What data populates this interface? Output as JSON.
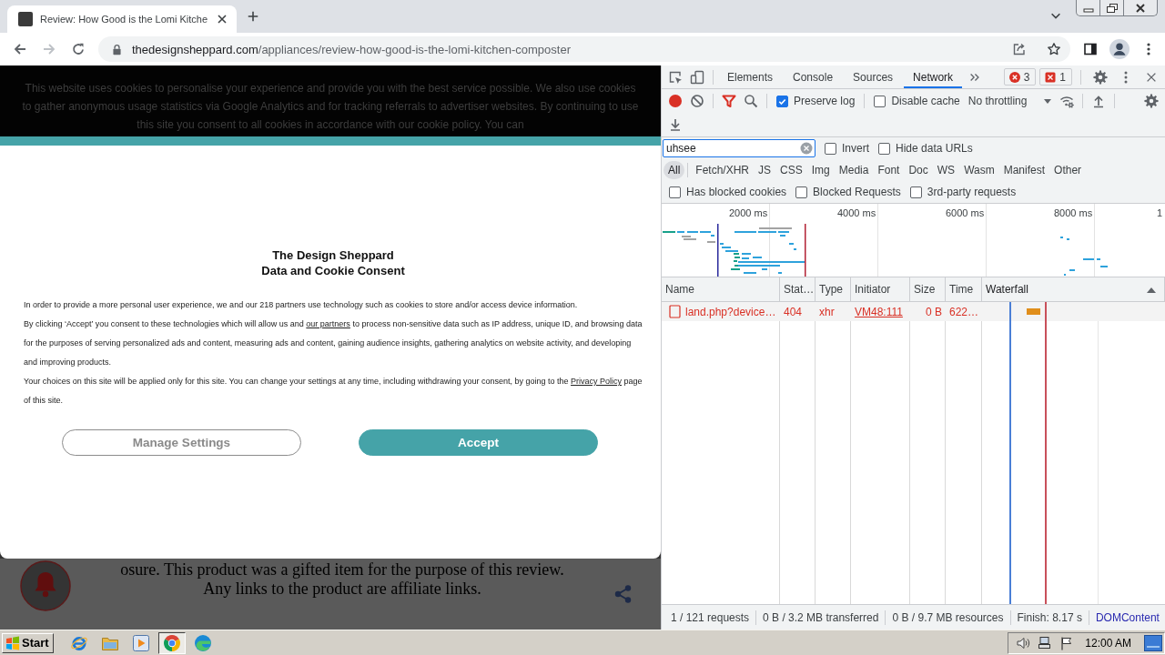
{
  "browser": {
    "tabs": [
      {
        "title": "Review: How Good is the Lomi Kitche",
        "selected": true
      }
    ],
    "navigation": [
      {
        "kind": "back",
        "disabled": false
      },
      {
        "kind": "forward",
        "disabled": true
      },
      {
        "kind": "reload",
        "disabled": false
      }
    ],
    "address": {
      "domain": "thedesignsheppard.com",
      "path": "/appliances/review-how-good-is-the-lomi-kitchen-composter"
    }
  },
  "page": {
    "cookie_notice": "This website uses cookies to personalise your experience and provide you with the best service possible. We also use cookies to gather anonymous usage statistics via Google Analytics and for tracking referrals to advertiser websites. By continuing to use this site you consent to all cookies in accordance with our cookie policy. You can",
    "consent_dialog": {
      "title": [
        "The Design Sheppard",
        "Data and Cookie Consent"
      ],
      "paragraphs": [
        [
          {
            "text": "In order to provide a more personal user experience, we and our 218 partners use technology such as cookies to store and/or access device information."
          }
        ],
        [
          {
            "text": "By clicking ‘Accept’ you consent to these technologies which will allow us and "
          },
          {
            "text": "our partners",
            "link": true
          },
          {
            "text": " to process non-sensitive data such as IP address, unique ID, and browsing data for the purposes of serving personalized ads and content, measuring ads and content, gaining audience insights, gathering analytics on website activity, and developing and improving products."
          }
        ],
        [
          {
            "text": "Your choices on this site will be applied only for this site. You can change your settings at any time, including withdrawing your consent, by going to the "
          },
          {
            "text": "Privacy Policy",
            "link": true
          },
          {
            "text": " page of this site."
          }
        ]
      ],
      "buttons": [
        {
          "label": "Manage Settings",
          "kind": "outline"
        },
        {
          "label": "Accept",
          "kind": "filled"
        }
      ]
    },
    "article_lines": [
      "osure. This product was a gifted item for the purpose of this review.",
      "Any links to the product are affiliate links."
    ]
  },
  "devtools": {
    "tabs": [
      {
        "label": "Elements",
        "selected": false
      },
      {
        "label": "Console",
        "selected": false
      },
      {
        "label": "Sources",
        "selected": false
      },
      {
        "label": "Network",
        "selected": true
      }
    ],
    "counters": [
      {
        "kind": "error",
        "count": "3"
      },
      {
        "kind": "issue",
        "count": "1"
      }
    ],
    "toolbar": {
      "options": [
        {
          "label": "Preserve log",
          "checked": true
        },
        {
          "label": "Disable cache",
          "checked": false
        }
      ],
      "throttling": "No throttling"
    },
    "filter": {
      "value": "uhsee",
      "options": [
        {
          "label": "Invert",
          "checked": false
        },
        {
          "label": "Hide data URLs",
          "checked": false
        }
      ]
    },
    "types": [
      {
        "label": "All",
        "selected": true
      },
      {
        "label": "Fetch/XHR",
        "selected": false
      },
      {
        "label": "JS",
        "selected": false
      },
      {
        "label": "CSS",
        "selected": false
      },
      {
        "label": "Img",
        "selected": false
      },
      {
        "label": "Media",
        "selected": false
      },
      {
        "label": "Font",
        "selected": false
      },
      {
        "label": "Doc",
        "selected": false
      },
      {
        "label": "WS",
        "selected": false
      },
      {
        "label": "Wasm",
        "selected": false
      },
      {
        "label": "Manifest",
        "selected": false
      },
      {
        "label": "Other",
        "selected": false
      }
    ],
    "blocked_filters": [
      {
        "label": "Has blocked cookies",
        "checked": false
      },
      {
        "label": "Blocked Requests",
        "checked": false
      },
      {
        "label": "3rd-party requests",
        "checked": false
      }
    ],
    "overview": {
      "ticks": [
        "2000 ms",
        "4000 ms",
        "6000 ms",
        "8000 ms",
        "1"
      ]
    },
    "table": {
      "columns": [
        {
          "label": "Name",
          "sorted": false
        },
        {
          "label": "Stat…",
          "sorted": false
        },
        {
          "label": "Type",
          "sorted": false
        },
        {
          "label": "Initiator",
          "sorted": false
        },
        {
          "label": "Size",
          "sorted": false
        },
        {
          "label": "Time",
          "sorted": false
        },
        {
          "label": "Waterfall",
          "sorted": true
        }
      ],
      "rows": [
        {
          "name": "land.php?device…",
          "status": "404",
          "type": "xhr",
          "initiator": "VM48:111",
          "size": "0 B",
          "time": "622…",
          "failed": true
        }
      ]
    },
    "status_bar": [
      {
        "text": "1 / 121 requests",
        "kind": "summary"
      },
      {
        "text": "0 B / 3.2 MB transferred",
        "kind": "summary"
      },
      {
        "text": "0 B / 9.7 MB resources",
        "kind": "summary"
      },
      {
        "text": "Finish: 8.17 s",
        "kind": "summary"
      },
      {
        "text": "DOMContent",
        "kind": "dom_content_loaded"
      }
    ]
  },
  "taskbar": {
    "start": "Start",
    "apps": [
      {
        "kind": "ie",
        "selected": false
      },
      {
        "kind": "explorer",
        "selected": false
      },
      {
        "kind": "media_player",
        "selected": false
      },
      {
        "kind": "chrome",
        "selected": true
      },
      {
        "kind": "edge",
        "selected": false
      }
    ],
    "clock": "12:00 AM"
  }
}
